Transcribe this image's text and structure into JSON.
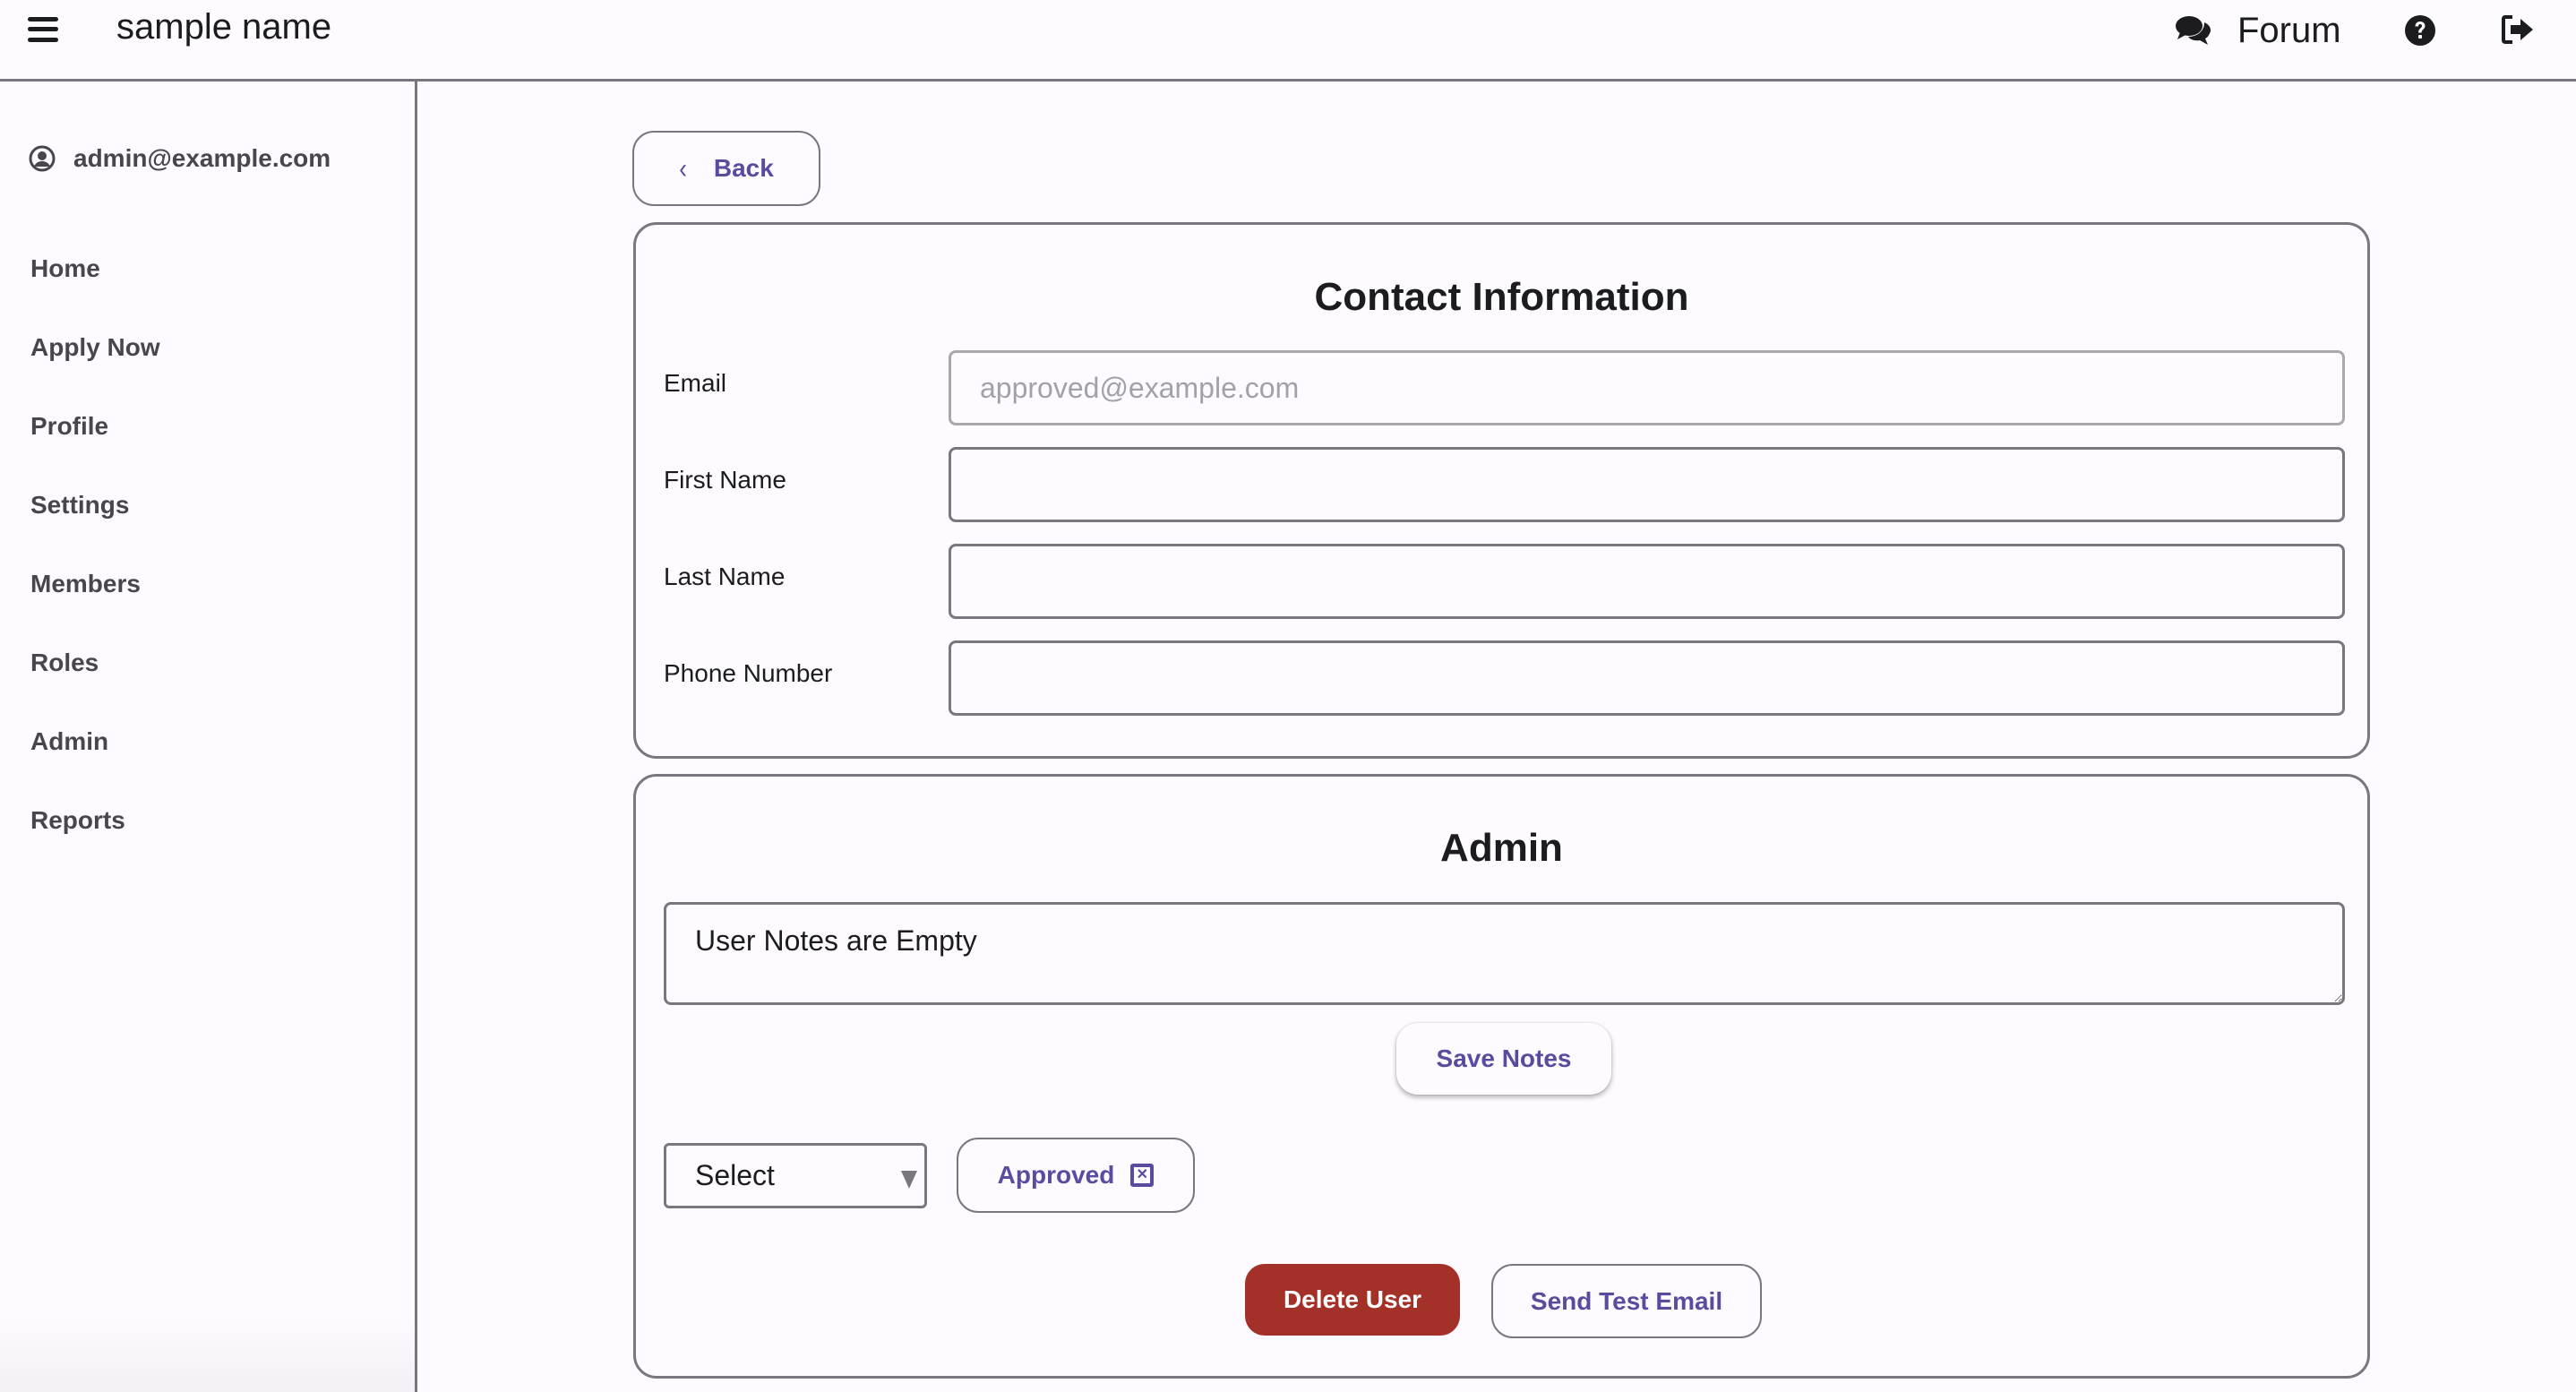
{
  "header": {
    "app_title": "sample name",
    "forum_label": "Forum",
    "icons": {
      "menu": "hamburger-icon",
      "forum": "comments-icon",
      "help": "question-circle-icon",
      "logout": "sign-out-icon"
    }
  },
  "sidebar": {
    "user_email": "admin@example.com",
    "user_icon": "user-circle-icon",
    "items": [
      {
        "label": "Home"
      },
      {
        "label": "Apply Now"
      },
      {
        "label": "Profile"
      },
      {
        "label": "Settings"
      },
      {
        "label": "Members"
      },
      {
        "label": "Roles"
      },
      {
        "label": "Admin"
      },
      {
        "label": "Reports"
      }
    ]
  },
  "main": {
    "back_label": "Back",
    "contact": {
      "title": "Contact Information",
      "fields": [
        {
          "label": "Email",
          "value": "approved@example.com",
          "disabled": true
        },
        {
          "label": "First Name",
          "value": ""
        },
        {
          "label": "Last Name",
          "value": ""
        },
        {
          "label": "Phone Number",
          "value": ""
        }
      ]
    },
    "admin": {
      "title": "Admin",
      "notes_value": "User Notes are Empty",
      "save_notes_label": "Save Notes",
      "role_select_value": "Select",
      "status_chip_label": "Approved",
      "delete_label": "Delete User",
      "send_test_email_label": "Send Test Email"
    }
  },
  "colors": {
    "accent": "#5b4a9e",
    "danger": "#a33128",
    "border": "#79767d",
    "background": "#fdfbff"
  }
}
